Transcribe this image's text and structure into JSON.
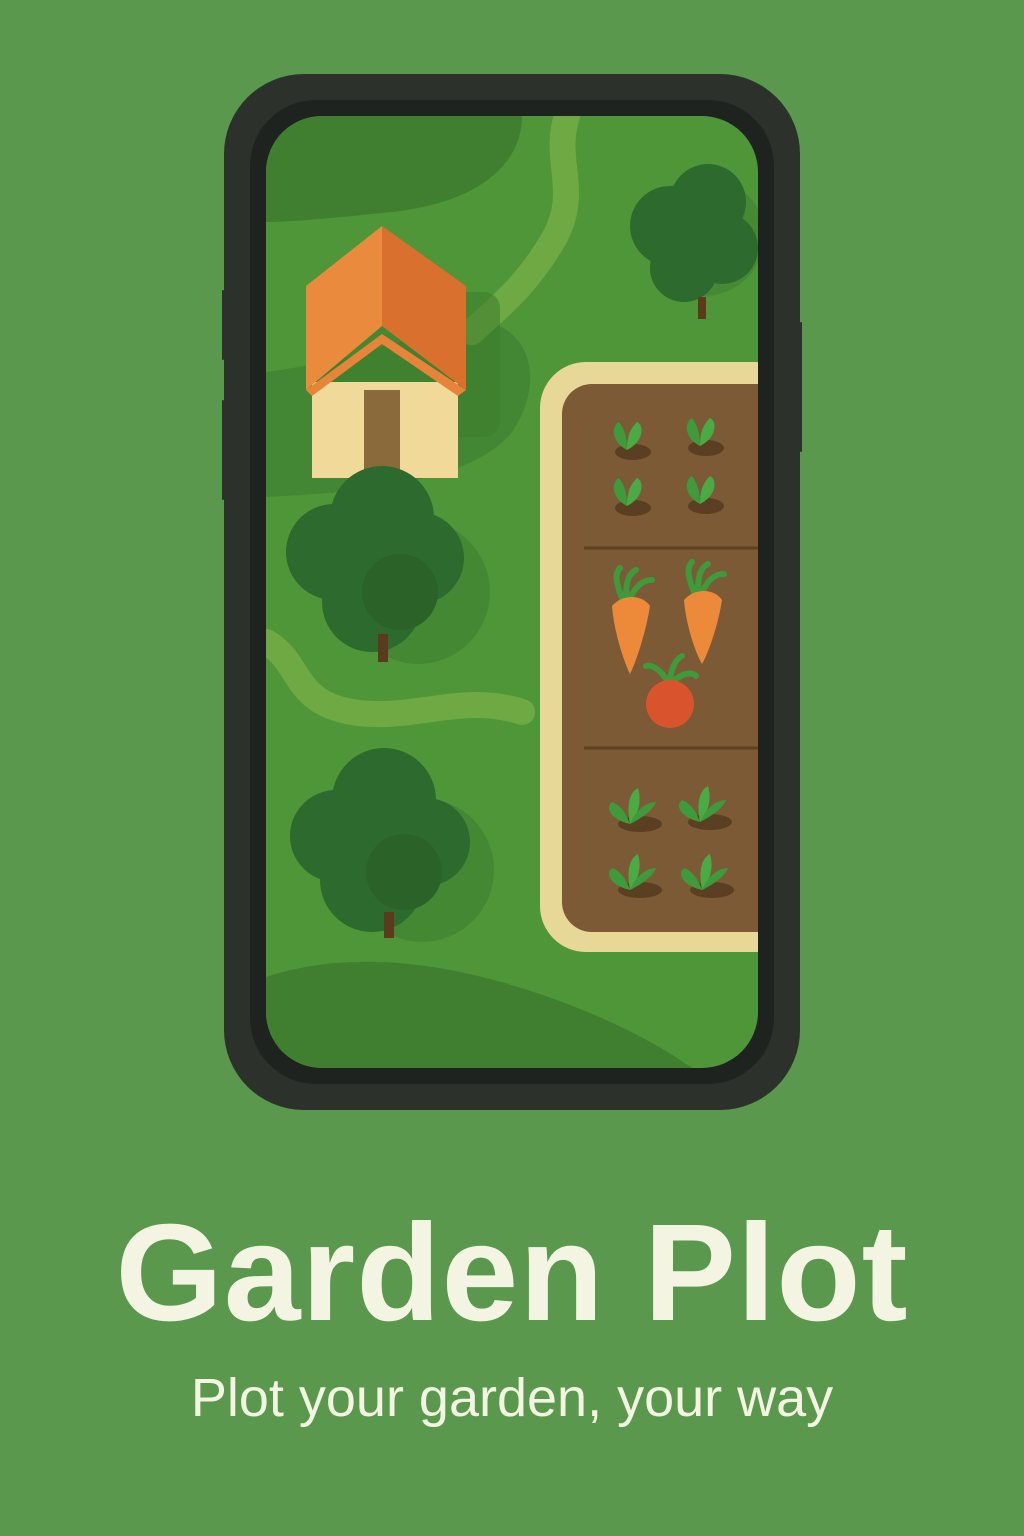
{
  "splash": {
    "app_name": "Garden Plot",
    "tagline": "Plot your garden, your way"
  },
  "colors": {
    "background": "#5a984d",
    "text": "#f3f5e2",
    "phone_frame": "#2c312c",
    "grass": "#4f9638",
    "path": "#72a945",
    "tree": "#2d6a2d",
    "roof": "#e8843a",
    "house_wall": "#f1d99a",
    "bed_border": "#e8d897",
    "soil": "#7b5a35",
    "leaf": "#3e9a3a",
    "carrot": "#ec8a3a",
    "radish": "#d9542c"
  },
  "illustration": {
    "house": "house-icon",
    "trees": [
      "tree-icon",
      "tree-icon",
      "tree-icon"
    ],
    "garden_bed_rows": [
      "seedlings",
      "carrots-and-radish",
      "lettuce"
    ]
  }
}
